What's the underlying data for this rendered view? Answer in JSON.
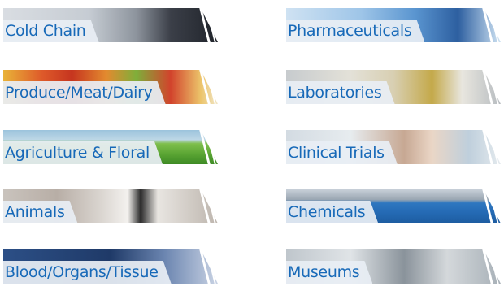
{
  "industries": {
    "left": [
      {
        "label": "Cold Chain"
      },
      {
        "label": "Produce/Meat/Dairy"
      },
      {
        "label": "Agriculture & Floral"
      },
      {
        "label": "Animals"
      },
      {
        "label": "Blood/Organs/Tissue"
      }
    ],
    "right": [
      {
        "label": "Pharmaceuticals"
      },
      {
        "label": "Laboratories"
      },
      {
        "label": "Clinical Trials"
      },
      {
        "label": "Chemicals"
      },
      {
        "label": "Museums"
      }
    ]
  },
  "colors": {
    "label_text": "#1769b8",
    "label_background": "#e8eef4",
    "page_background": "#ffffff"
  }
}
